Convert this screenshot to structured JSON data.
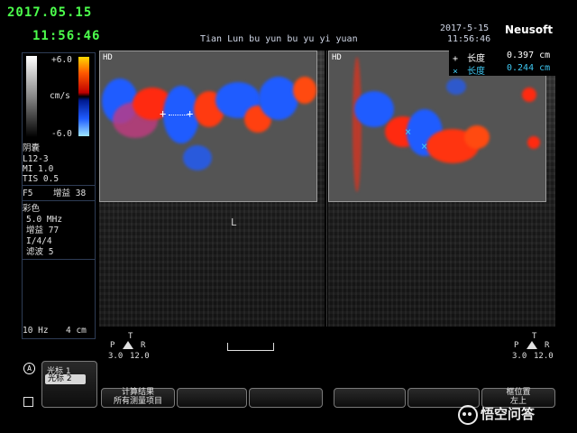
{
  "overlay": {
    "date": "2017.05.15",
    "time": "11:56:46"
  },
  "header": {
    "hospital": "Tian Lun bu yun bu yu yi yuan",
    "date": "2017-5-15",
    "time": "11:56:46",
    "brand": "Neusoft"
  },
  "color_scale": {
    "top": "+6.0",
    "unit": "cm/s",
    "bottom": "-6.0"
  },
  "params": {
    "exam": "阴囊",
    "probe": "L12-3",
    "mi": "MI 1.0",
    "tis": "TIS 0.5",
    "focus": "F5",
    "gain_label": "增益 38",
    "color_title": "彩色",
    "freq": "5.0 MHz",
    "color_gain": "增益 77",
    "ratio": "I/4/4",
    "filter": "滤波 5",
    "prf": "10 Hz",
    "depth": "4 cm"
  },
  "image_labels": {
    "hd": "HD",
    "left_mark": "L"
  },
  "measurements": [
    {
      "symbol": "+",
      "label": "长度",
      "value": "0.397 cm",
      "color": "#ffffff"
    },
    {
      "symbol": "×",
      "label": "长度",
      "value": "0.244 cm",
      "color": "#3ec6f0"
    }
  ],
  "orientation_left": {
    "t": "T",
    "p": "P",
    "r": "R",
    "v1": "3.0",
    "v2": "12.0"
  },
  "orientation_right": {
    "t": "T",
    "p": "P",
    "r": "R",
    "v1": "3.0",
    "v2": "12.0"
  },
  "cursor_panel": {
    "item1": "光标 1",
    "item2": "光标 2"
  },
  "softkeys": {
    "calc_line1": "计算结果",
    "calc_line2": "所有测量项目",
    "position_line1": "框位置",
    "position_line2": "左上"
  },
  "watermark": "悟空问答",
  "colors": {
    "overlay_green": "#4cff4c",
    "flow_red": "#ff2a10",
    "flow_blue": "#1f5cff",
    "measure_cyan": "#3ec6f0"
  }
}
